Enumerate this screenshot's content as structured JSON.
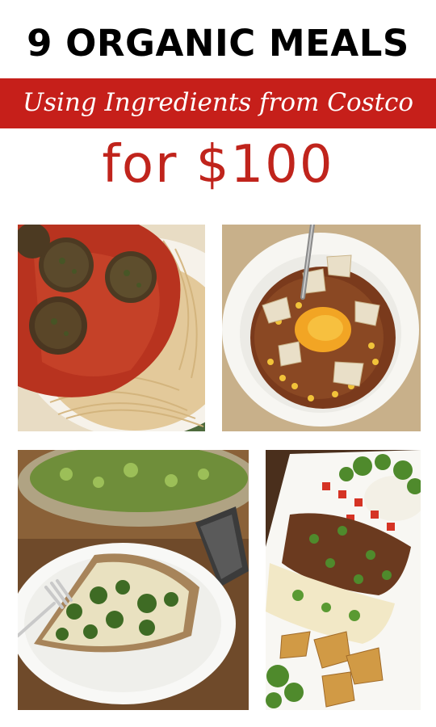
{
  "header": {
    "title": "9 ORGANIC MEALS",
    "subtitle": "Using Ingredients from Costco",
    "price_line": "for $100"
  },
  "colors": {
    "banner": "#c61f1a",
    "price_text": "#c0241c",
    "title_text": "#000000"
  },
  "photos": [
    {
      "subject": "spaghetti-and-meatballs"
    },
    {
      "subject": "tortilla-soup"
    },
    {
      "subject": "spinach-quiche"
    },
    {
      "subject": "taco-platter"
    }
  ]
}
